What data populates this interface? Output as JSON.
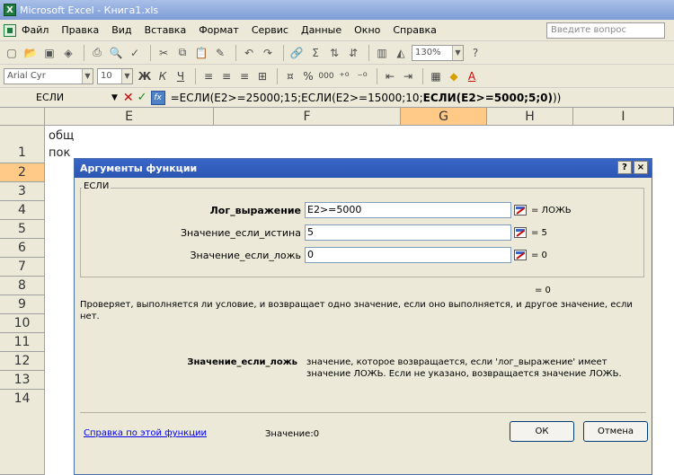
{
  "window": {
    "title": "Microsoft Excel - Книга1.xls"
  },
  "menu": {
    "items": [
      "Файл",
      "Правка",
      "Вид",
      "Вставка",
      "Формат",
      "Сервис",
      "Данные",
      "Окно",
      "Справка"
    ],
    "help_placeholder": "Введите вопрос"
  },
  "toolbar": {
    "zoom": "130%",
    "font_name": "Arial Cyr",
    "font_size": "10",
    "bold": "Ж",
    "italic": "К",
    "underline": "Ч",
    "percent": "%",
    "thousands": "000"
  },
  "formula_bar": {
    "name_box": "ЕСЛИ",
    "formula_prefix": "=ЕСЛИ(E2>=25000;15;ЕСЛИ(E2>=15000;10;",
    "formula_bold": "ЕСЛИ(E2>=5000;5;0)",
    "formula_suffix": "))"
  },
  "grid": {
    "columns": [
      "E",
      "F",
      "G",
      "H",
      "I"
    ],
    "rows": [
      "1",
      "2",
      "3",
      "4",
      "5",
      "6",
      "7",
      "8",
      "9",
      "10",
      "11",
      "12",
      "13",
      "14"
    ],
    "cell_e1_line1": "общ",
    "cell_e1_line2": "пок"
  },
  "dialog": {
    "title": "Аргументы функции",
    "help_btn": "?",
    "close_btn": "×",
    "function_name": "ЕСЛИ",
    "args": [
      {
        "label": "Лог_выражение",
        "value": "E2>=5000",
        "result": "= ЛОЖЬ"
      },
      {
        "label": "Значение_если_истина",
        "value": "5",
        "result": "= 5"
      },
      {
        "label": "Значение_если_ложь",
        "value": "0",
        "result": "= 0"
      }
    ],
    "total_result": "= 0",
    "description": "Проверяет, выполняется ли условие, и возвращает одно значение, если оно выполняется, и другое значение, если нет.",
    "arg_help_label": "Значение_если_ложь",
    "arg_help_text": "значение, которое возвращается, если 'лог_выражение' имеет значение ЛОЖЬ. Если не указано, возвращается значение ЛОЖЬ.",
    "help_link": "Справка по этой функции",
    "value_label": "Значение:",
    "value": "0",
    "ok": "ОК",
    "cancel": "Отмена"
  }
}
